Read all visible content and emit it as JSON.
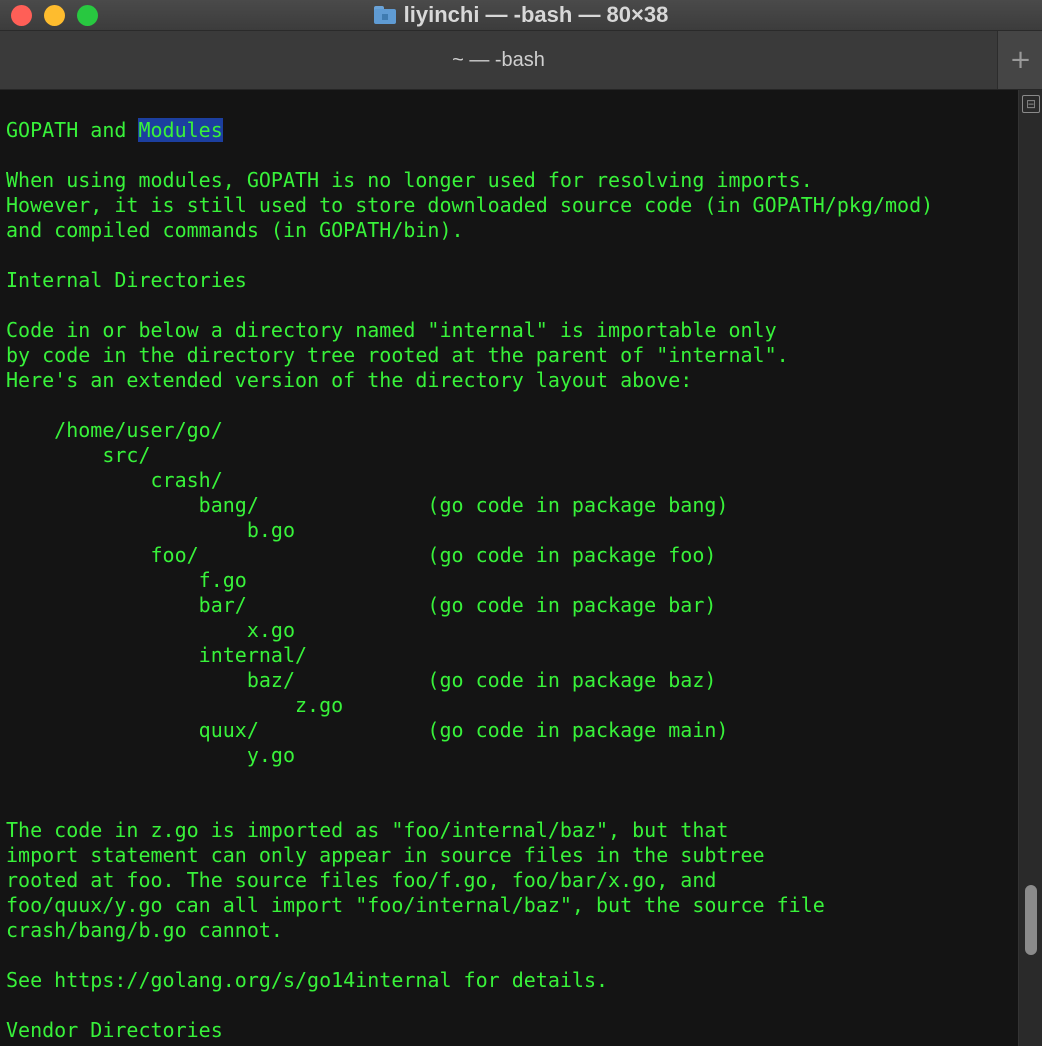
{
  "window": {
    "title": "liyinchi — -bash — 80×38",
    "tab_label": "~ — -bash",
    "add_tab_label": "+",
    "split_label": "⊟"
  },
  "colors": {
    "text": "#38f23a",
    "highlight": "#1c3fa0",
    "background": "#141414"
  },
  "terminal": {
    "line0a": "GOPATH and ",
    "line0b": "Modules",
    "lines": [
      "",
      "When using modules, GOPATH is no longer used for resolving imports.",
      "However, it is still used to store downloaded source code (in GOPATH/pkg/mod)",
      "and compiled commands (in GOPATH/bin).",
      "",
      "Internal Directories",
      "",
      "Code in or below a directory named \"internal\" is importable only",
      "by code in the directory tree rooted at the parent of \"internal\".",
      "Here's an extended version of the directory layout above:",
      "",
      "    /home/user/go/",
      "        src/",
      "            crash/",
      "                bang/              (go code in package bang)",
      "                    b.go",
      "            foo/                   (go code in package foo)",
      "                f.go",
      "                bar/               (go code in package bar)",
      "                    x.go",
      "                internal/",
      "                    baz/           (go code in package baz)",
      "                        z.go",
      "                quux/              (go code in package main)",
      "                    y.go",
      "",
      "",
      "The code in z.go is imported as \"foo/internal/baz\", but that",
      "import statement can only appear in source files in the subtree",
      "rooted at foo. The source files foo/f.go, foo/bar/x.go, and",
      "foo/quux/y.go can all import \"foo/internal/baz\", but the source file",
      "crash/bang/b.go cannot.",
      "",
      "See https://golang.org/s/go14internal for details.",
      "",
      "Vendor Directories"
    ]
  }
}
